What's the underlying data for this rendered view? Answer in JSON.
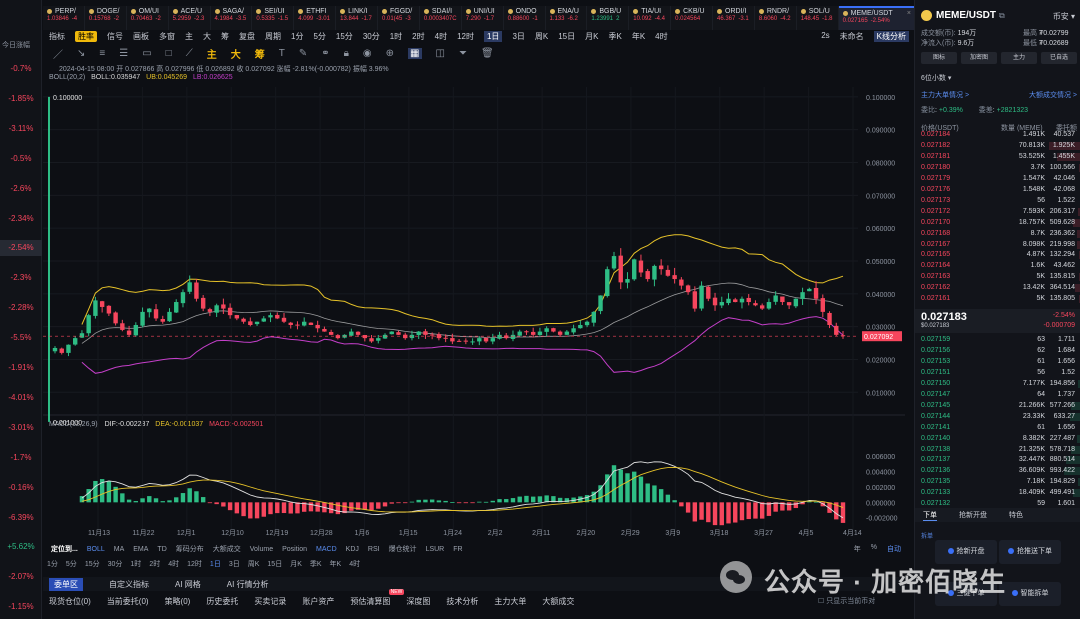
{
  "left_panel": {
    "header": "今日涨幅",
    "rows": [
      {
        "v": "-0.7%",
        "dir": "down"
      },
      {
        "v": "-1.85%",
        "dir": "down"
      },
      {
        "v": "-3.11%",
        "dir": "down"
      },
      {
        "v": "-0.5%",
        "dir": "down"
      },
      {
        "v": "-2.6%",
        "dir": "down"
      },
      {
        "v": "-2.34%",
        "dir": "down"
      },
      {
        "v": "-2.54%",
        "dir": "down",
        "selected": true
      },
      {
        "v": "-2.3%",
        "dir": "down"
      },
      {
        "v": "-2.28%",
        "dir": "down"
      },
      {
        "v": "-5.5%",
        "dir": "down"
      },
      {
        "v": "-1.91%",
        "dir": "down"
      },
      {
        "v": "-4.01%",
        "dir": "down"
      },
      {
        "v": "-3.01%",
        "dir": "down"
      },
      {
        "v": "-1.7%",
        "dir": "down"
      },
      {
        "v": "-0.16%",
        "dir": "down"
      },
      {
        "v": "-6.39%",
        "dir": "down"
      },
      {
        "v": "+5.62%",
        "dir": "up"
      },
      {
        "v": "-2.07%",
        "dir": "down"
      },
      {
        "v": "-1.15%",
        "dir": "down"
      },
      {
        "v": "-1.61%",
        "dir": "down"
      }
    ]
  },
  "tickers": [
    {
      "name": "PERP/",
      "price": "1.03846",
      "chg": "-4",
      "dir": "down"
    },
    {
      "name": "DOGE/",
      "price": "0.15768",
      "chg": "-2",
      "dir": "down"
    },
    {
      "name": "OM/UI",
      "price": "0.70463",
      "chg": "-2",
      "dir": "down"
    },
    {
      "name": "ACE/U",
      "price": "5.2959",
      "chg": "-2.3",
      "dir": "down"
    },
    {
      "name": "SAGA/",
      "price": "4.1984",
      "chg": "-3.5",
      "dir": "down"
    },
    {
      "name": "SEI/UI",
      "price": "0.5335",
      "chg": "-1.5",
      "dir": "down"
    },
    {
      "name": "ETHFI",
      "price": "4.099",
      "chg": "-3.01",
      "dir": "down"
    },
    {
      "name": "LINK/I",
      "price": "13.844",
      "chg": "-1.7",
      "dir": "down"
    },
    {
      "name": "FGGD/",
      "price": "0.01(45",
      "chg": "-3",
      "dir": "down"
    },
    {
      "name": "SDAI/I",
      "price": "0.0003407C",
      "chg": "",
      "dir": "down"
    },
    {
      "name": "UNI/UI",
      "price": "7.290",
      "chg": "-1.7",
      "dir": "down"
    },
    {
      "name": "ONDO",
      "price": "0.88600",
      "chg": "-1",
      "dir": "down"
    },
    {
      "name": "ENA/U",
      "price": "1.133",
      "chg": "-6.2",
      "dir": "down"
    },
    {
      "name": "BGB/U",
      "price": "1.23991",
      "chg": "2",
      "dir": "up"
    },
    {
      "name": "TIA/UI",
      "price": "10.092",
      "chg": "-4.4",
      "dir": "down"
    },
    {
      "name": "CKB/U",
      "price": "0.024564",
      "chg": "",
      "dir": "down"
    },
    {
      "name": "ORDI/I",
      "price": "46.367",
      "chg": "-3.1",
      "dir": "down"
    },
    {
      "name": "RNDR/",
      "price": "8.6060",
      "chg": "-4.2",
      "dir": "down"
    },
    {
      "name": "SOL/U",
      "price": "148.45",
      "chg": "-1.8",
      "dir": "down"
    },
    {
      "name": "MEME/USDT",
      "price": "0.027165",
      "chg": "-2.54%",
      "dir": "down",
      "selected": true
    }
  ],
  "toolbar1": {
    "items": [
      "指标",
      "胜率",
      "信号",
      "画板",
      "多窗",
      "主",
      "大",
      "筹",
      "复盘",
      "周期",
      "1分",
      "5分",
      "15分",
      "30分",
      "1时",
      "2时",
      "4时",
      "12时",
      "1日",
      "3日",
      "周K",
      "15日",
      "月K",
      "季K",
      "年K",
      "4时"
    ],
    "active": "1日",
    "tag": "胜率",
    "right": [
      "2s",
      "未命名",
      "K线分析"
    ]
  },
  "toolbar2": {
    "tw_labels": [
      "主",
      "大",
      "筹"
    ]
  },
  "ohlc_line": "2024-04-15 08:00  开 0.027866  高 0.027996  低 0.026892  收 0.027092  涨幅 -2.81%(-0.000782)  振幅 3.96%",
  "boll_line": {
    "name": "BOLL(20,2)",
    "boll": "BOLL:0.035947",
    "ub": "UB:0.045269",
    "lb": "LB:0.026625"
  },
  "macd_line": {
    "name": "MACD(12,26,9)",
    "dif": "DIF:-0.002287",
    "dea": "DEA:-0.001037",
    "macd": "MACD:-0.002501"
  },
  "chart_data": {
    "type": "candlestick",
    "y_main_ticks": [
      "0.100000",
      "0.090000",
      "0.080000",
      "0.070000",
      "0.060000",
      "0.050000",
      "0.040000",
      "0.030000",
      "0.020000",
      "0.010000"
    ],
    "y_main_range": [
      0.004,
      0.103
    ],
    "y_macd_ticks": [
      "0.006000",
      "0.004000",
      "0.002000",
      "0.000000",
      "-0.002000"
    ],
    "y_macd_range": [
      -0.0036,
      0.0072
    ],
    "x_ticks": [
      "11月13",
      "11月22",
      "12月1",
      "12月10",
      "12月19",
      "12月28",
      "1月6",
      "1月15",
      "1月24",
      "2月2",
      "2月11",
      "2月20",
      "2月29",
      "3月9",
      "3月18",
      "3月27",
      "4月5",
      "4月14"
    ],
    "current_price_tag": "0.027092",
    "max_label": "0.100000",
    "min_label": "0.001000",
    "closes": [
      0.0235,
      0.022,
      0.0245,
      0.0265,
      0.028,
      0.0335,
      0.038,
      0.036,
      0.034,
      0.031,
      0.029,
      0.0275,
      0.0305,
      0.0345,
      0.0355,
      0.0325,
      0.0315,
      0.0345,
      0.0375,
      0.0405,
      0.0435,
      0.0385,
      0.0355,
      0.0345,
      0.0365,
      0.0355,
      0.0335,
      0.0325,
      0.0315,
      0.0305,
      0.0315,
      0.0325,
      0.0335,
      0.0325,
      0.0315,
      0.0305,
      0.0305,
      0.0315,
      0.0305,
      0.0295,
      0.0285,
      0.0275,
      0.0265,
      0.0275,
      0.0285,
      0.0275,
      0.0265,
      0.0255,
      0.0265,
      0.0275,
      0.0285,
      0.0275,
      0.0265,
      0.0275,
      0.0285,
      0.0275,
      0.0275,
      0.0265,
      0.0265,
      0.0255,
      0.0255,
      0.0255,
      0.0255,
      0.0265,
      0.0255,
      0.0265,
      0.0275,
      0.0265,
      0.0275,
      0.0285,
      0.0285,
      0.0275,
      0.0285,
      0.0295,
      0.0285,
      0.0275,
      0.0285,
      0.0295,
      0.0305,
      0.0315,
      0.0345,
      0.0395,
      0.0475,
      0.0515,
      0.0435,
      0.0445,
      0.0505,
      0.0465,
      0.0445,
      0.0485,
      0.0475,
      0.0455,
      0.0445,
      0.0425,
      0.0405,
      0.0355,
      0.0425,
      0.0385,
      0.0365,
      0.0375,
      0.0385,
      0.0375,
      0.0385,
      0.0375,
      0.0365,
      0.0355,
      0.0375,
      0.0395,
      0.0375,
      0.0365,
      0.0385,
      0.0405,
      0.0415,
      0.0385,
      0.0345,
      0.0305,
      0.0275,
      0.0271
    ]
  },
  "bottom": {
    "ind_tabs": [
      "定位到...",
      "BOLL",
      "MA",
      "EMA",
      "TD",
      "筹码分布",
      "大额成交",
      "Volume",
      "Position",
      "MACD",
      "KDJ",
      "RSI",
      "爆仓统计",
      "LSUR",
      "FR"
    ],
    "ind_on": [
      "BOLL",
      "MACD"
    ],
    "periods": [
      "1分",
      "5分",
      "15分",
      "30分",
      "1时",
      "2时",
      "4时",
      "12时",
      "1日",
      "3日",
      "周K",
      "15日",
      "月K",
      "季K",
      "年K",
      "4时"
    ],
    "period_on": "1日",
    "right_controls": [
      "年",
      "%",
      "自动"
    ],
    "tabs1": [
      "委单区",
      "自定义指标",
      "AI 网格",
      "AI 行情分析"
    ],
    "tabs2": [
      {
        "label": "现货仓位(0)",
        "on": true
      },
      {
        "label": "当前委托(0)"
      },
      {
        "label": "策略(0)"
      },
      {
        "label": "历史委托"
      },
      {
        "label": "买卖记录"
      },
      {
        "label": "账户资产"
      },
      {
        "label": "预估清算图",
        "new": "NEW"
      },
      {
        "label": "深度图"
      },
      {
        "label": "技术分析"
      },
      {
        "label": "主力大单"
      },
      {
        "label": "大额成交"
      }
    ],
    "only_current": "只显示当前币对"
  },
  "right_panel": {
    "pair": "MEME/USDT",
    "currency": "币安",
    "vol_label": "成交额(币)",
    "vol_value": "194万",
    "net_label": "净流入(币)",
    "net_value": "9.6万",
    "high_label": "最高",
    "high_value": "₮0.02799",
    "low_label": "最低",
    "low_value": "₮0.02689",
    "buttons": [
      "图标",
      "加密图",
      "主力",
      "已自选"
    ],
    "decimals": "6位小数",
    "link_left": "主力大单情况 >",
    "link_right": "大额成交情况 >",
    "ratio_label": "委比",
    "ratio_value": "+0.39%",
    "diff_label": "委差",
    "diff_value": "+2821323",
    "ob_headers": [
      "价格(USDT)",
      "数量 (MEME)",
      "委托额"
    ],
    "asks": [
      [
        "0.027184",
        "1.491K",
        "40.537"
      ],
      [
        "0.027182",
        "70.813K",
        "1.925K"
      ],
      [
        "0.027181",
        "53.525K",
        "1.455K"
      ],
      [
        "0.027180",
        "3.7K",
        "100.566"
      ],
      [
        "0.027179",
        "1.547K",
        "42.046"
      ],
      [
        "0.027176",
        "1.548K",
        "42.068"
      ],
      [
        "0.027173",
        "56",
        "1.522"
      ],
      [
        "0.027172",
        "7.593K",
        "206.317"
      ],
      [
        "0.027170",
        "18.757K",
        "509.628"
      ],
      [
        "0.027168",
        "8.7K",
        "236.362"
      ],
      [
        "0.027167",
        "8.098K",
        "219.998"
      ],
      [
        "0.027165",
        "4.87K",
        "132.294"
      ],
      [
        "0.027164",
        "1.6K",
        "43.462"
      ],
      [
        "0.027163",
        "5K",
        "135.815"
      ],
      [
        "0.027162",
        "13.42K",
        "364.514"
      ],
      [
        "0.027161",
        "5K",
        "135.805"
      ]
    ],
    "last_price": "0.027183",
    "last_sub": "$0.027183",
    "last_pct": "-2.54%",
    "last_change": "-0.000709",
    "bids": [
      [
        "0.027159",
        "63",
        "1.711"
      ],
      [
        "0.027156",
        "62",
        "1.684"
      ],
      [
        "0.027153",
        "61",
        "1.656"
      ],
      [
        "0.027151",
        "56",
        "1.52"
      ],
      [
        "0.027150",
        "7.177K",
        "194.856"
      ],
      [
        "0.027147",
        "64",
        "1.737"
      ],
      [
        "0.027145",
        "21.266K",
        "577.266"
      ],
      [
        "0.027144",
        "23.33K",
        "633.27"
      ],
      [
        "0.027141",
        "61",
        "1.656"
      ],
      [
        "0.027140",
        "8.382K",
        "227.487"
      ],
      [
        "0.027138",
        "21.325K",
        "578.718"
      ],
      [
        "0.027137",
        "32.447K",
        "880.514"
      ],
      [
        "0.027136",
        "36.609K",
        "993.422"
      ],
      [
        "0.027135",
        "7.18K",
        "194.829"
      ],
      [
        "0.027133",
        "18.409K",
        "499.491"
      ],
      [
        "0.027132",
        "59",
        "1.601"
      ]
    ],
    "trade_tabs": [
      "下单",
      "抢新开盘",
      "特色"
    ],
    "cards": [
      "抢新开盘",
      "抢推送下单",
      "三键下单",
      "智能拆单"
    ],
    "foot": "拆单"
  },
  "watermark": "公众号 · 加密佰晓生",
  "colors": {
    "up": "#2ebd85",
    "down": "#f6465d",
    "boll_mid": "#d7d7d7",
    "boll_ub": "#e6c229",
    "boll_lb": "#c43fc9",
    "dif": "#e0e0e0",
    "dea": "#e6c229",
    "accent": "#3a6ff7"
  }
}
